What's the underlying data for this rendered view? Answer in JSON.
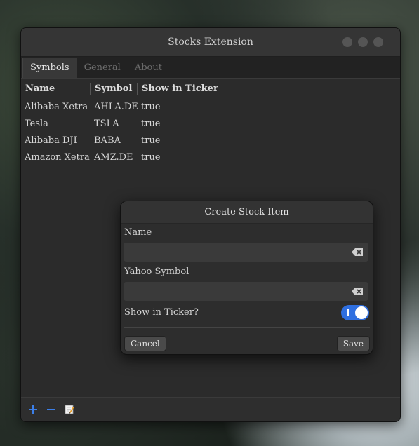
{
  "window": {
    "title": "Stocks Extension"
  },
  "tabs": [
    "Symbols",
    "General",
    "About"
  ],
  "table": {
    "headers": [
      "Name",
      "Symbol",
      "Show in Ticker"
    ],
    "rows": [
      [
        "Alibaba Xetra",
        "AHLA.DE",
        "true"
      ],
      [
        "Tesla",
        "TSLA",
        "true"
      ],
      [
        "Alibaba DJI",
        "BABA",
        "true"
      ],
      [
        "Amazon Xetra",
        "AMZ.DE",
        "true"
      ]
    ]
  },
  "toolbar": {
    "add_icon": "plus-icon",
    "remove_icon": "minus-icon",
    "edit_icon": "edit-icon"
  },
  "dialog": {
    "title": "Create Stock Item",
    "name_label": "Name",
    "name_value": "",
    "symbol_label": "Yahoo Symbol",
    "symbol_value": "",
    "ticker_label": "Show in Ticker?",
    "ticker_on": true,
    "cancel_label": "Cancel",
    "save_label": "Save"
  },
  "colors": {
    "accent": "#2f6fe0",
    "window_bg": "#2b2b2b"
  }
}
